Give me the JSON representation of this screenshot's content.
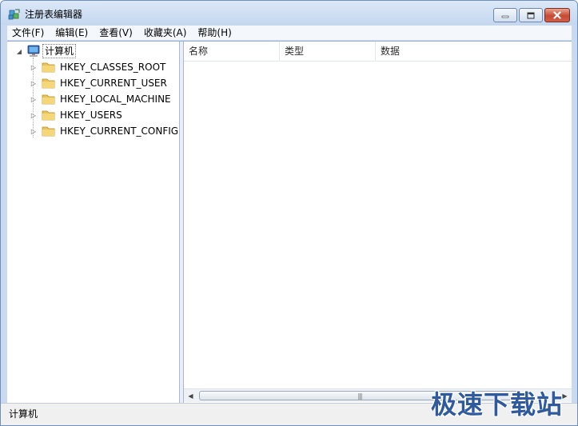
{
  "window": {
    "title": "注册表编辑器",
    "icon": "registry-editor-icon",
    "controls": {
      "minimize_icon": "minimize-icon",
      "maximize_icon": "maximize-icon",
      "close_icon": "close-icon"
    }
  },
  "menu": [
    {
      "label": "文件(F)"
    },
    {
      "label": "编辑(E)"
    },
    {
      "label": "查看(V)"
    },
    {
      "label": "收藏夹(A)"
    },
    {
      "label": "帮助(H)"
    }
  ],
  "tree": {
    "root": {
      "label": "计算机",
      "icon": "computer-icon",
      "expanded": true
    },
    "children": [
      {
        "label": "HKEY_CLASSES_ROOT",
        "icon": "folder-icon"
      },
      {
        "label": "HKEY_CURRENT_USER",
        "icon": "folder-icon"
      },
      {
        "label": "HKEY_LOCAL_MACHINE",
        "icon": "folder-icon"
      },
      {
        "label": "HKEY_USERS",
        "icon": "folder-icon"
      },
      {
        "label": "HKEY_CURRENT_CONFIG",
        "icon": "folder-icon"
      }
    ]
  },
  "list": {
    "columns": [
      {
        "label": "名称"
      },
      {
        "label": "类型"
      },
      {
        "label": "数据"
      }
    ],
    "rows": []
  },
  "status": {
    "path": "计算机"
  },
  "watermark": {
    "text": "极速下载站"
  },
  "colors": {
    "title_bar": "#c9d9ee",
    "close_button": "#c74a32",
    "folder": "#e8c25a",
    "watermark": "#2f5a9e"
  }
}
